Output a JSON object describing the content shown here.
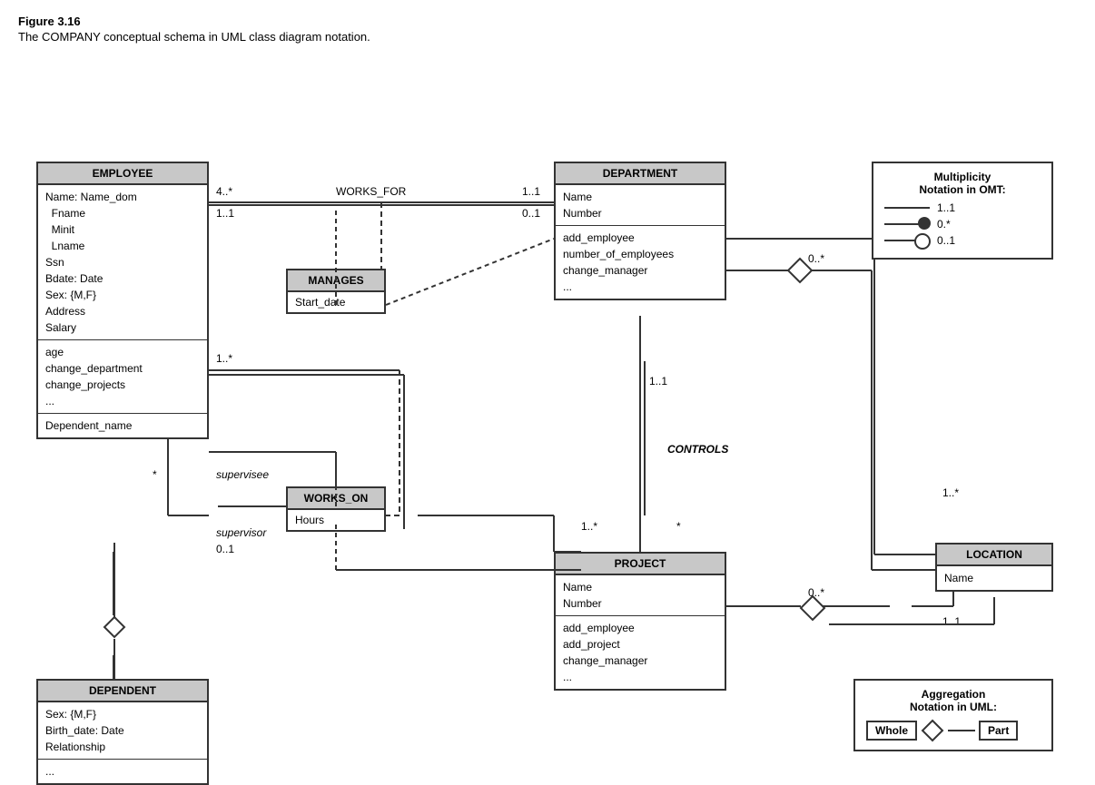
{
  "figure": {
    "title": "Figure 3.16",
    "caption": "The COMPANY conceptual schema in UML class diagram notation."
  },
  "classes": {
    "employee": {
      "header": "EMPLOYEE",
      "section1": [
        "Name: Name_dom",
        "  Fname",
        "  Minit",
        "  Lname",
        "Ssn",
        "Bdate: Date",
        "Sex: {M,F}",
        "Address",
        "Salary"
      ],
      "section2": [
        "age",
        "change_department",
        "change_projects",
        "..."
      ],
      "section3": [
        "Dependent_name"
      ]
    },
    "department": {
      "header": "DEPARTMENT",
      "section1": [
        "Name",
        "Number"
      ],
      "section2": [
        "add_employee",
        "number_of_employees",
        "change_manager",
        "..."
      ]
    },
    "project": {
      "header": "PROJECT",
      "section1": [
        "Name",
        "Number"
      ],
      "section2": [
        "add_employee",
        "add_project",
        "change_manager",
        "..."
      ]
    },
    "dependent": {
      "header": "DEPENDENT",
      "section1": [
        "Sex: {M,F}",
        "Birth_date: Date",
        "Relationship"
      ],
      "section2": [
        "..."
      ]
    },
    "location": {
      "header": "LOCATION",
      "section1": [
        "Name"
      ]
    }
  },
  "assoc_boxes": {
    "manages": {
      "header": "MANAGES",
      "body": "Start_date"
    },
    "works_on": {
      "header": "WORKS_ON",
      "body": "Hours"
    }
  },
  "labels": {
    "works_for": "WORKS_FOR",
    "controls": "CONTROLS",
    "supervisee": "supervisee",
    "supervisor": "supervisor"
  },
  "multiplicities": {
    "wf_left": "4..*",
    "wf_right": "1..1",
    "manages_left": "1..1",
    "manages_right": "0..1",
    "supervise_top": "1..*",
    "supervise_star": "*",
    "supervise_bottom": "0..1",
    "controls_dept": "1..1",
    "controls_proj": "1..*",
    "controls_star": "*",
    "dept_location": "0..*",
    "location_dept": "1..*",
    "location_bottom": "1..1",
    "project_agg": "0..*"
  },
  "notation": {
    "title1": "Multiplicity",
    "title2": "Notation in OMT:",
    "row1_label": "1..1",
    "row2_label": "0.*",
    "row3_label": "0..1"
  },
  "aggregation": {
    "title1": "Aggregation",
    "title2": "Notation in UML:",
    "whole_label": "Whole",
    "part_label": "Part"
  }
}
